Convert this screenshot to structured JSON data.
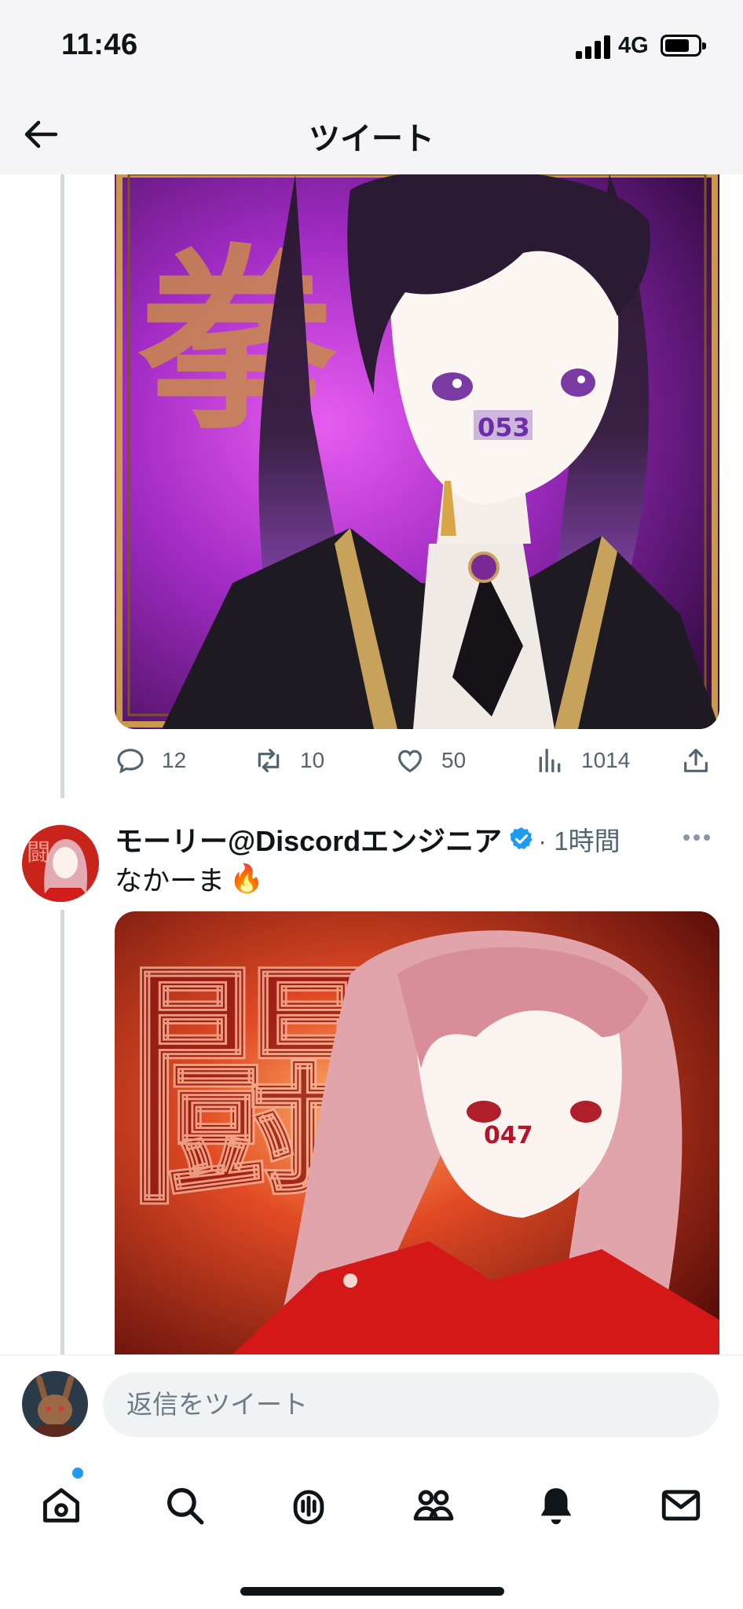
{
  "status_bar": {
    "time": "11:46",
    "network": "4G",
    "battery_level": 0.75
  },
  "header": {
    "title": "ツイート"
  },
  "tweet1": {
    "media_badge": "053",
    "media_glyph": "拳",
    "actions": {
      "replies": "12",
      "retweets": "10",
      "likes": "50",
      "views": "1014"
    }
  },
  "tweet2": {
    "display_name": "モーリー@Discordエンジニア",
    "time": "· 1時間",
    "text": "なかーま",
    "emoji": "🔥",
    "media_badge": "047",
    "media_glyph": "闘"
  },
  "reply": {
    "placeholder": "返信をツイート"
  },
  "icons": {
    "back": "back-arrow-icon",
    "reply": "reply-icon",
    "retweet": "retweet-icon",
    "like": "heart-icon",
    "views": "views-icon",
    "share": "share-icon",
    "verified": "verified-badge-icon",
    "more": "more-icon",
    "tabs": [
      "home-icon",
      "search-icon",
      "spaces-icon",
      "communities-icon",
      "notifications-icon",
      "messages-icon"
    ]
  },
  "colors": {
    "accent": "#1d9bf0",
    "text": "#0f1419",
    "secondary": "#536471",
    "thread_line": "#cfd9de"
  }
}
